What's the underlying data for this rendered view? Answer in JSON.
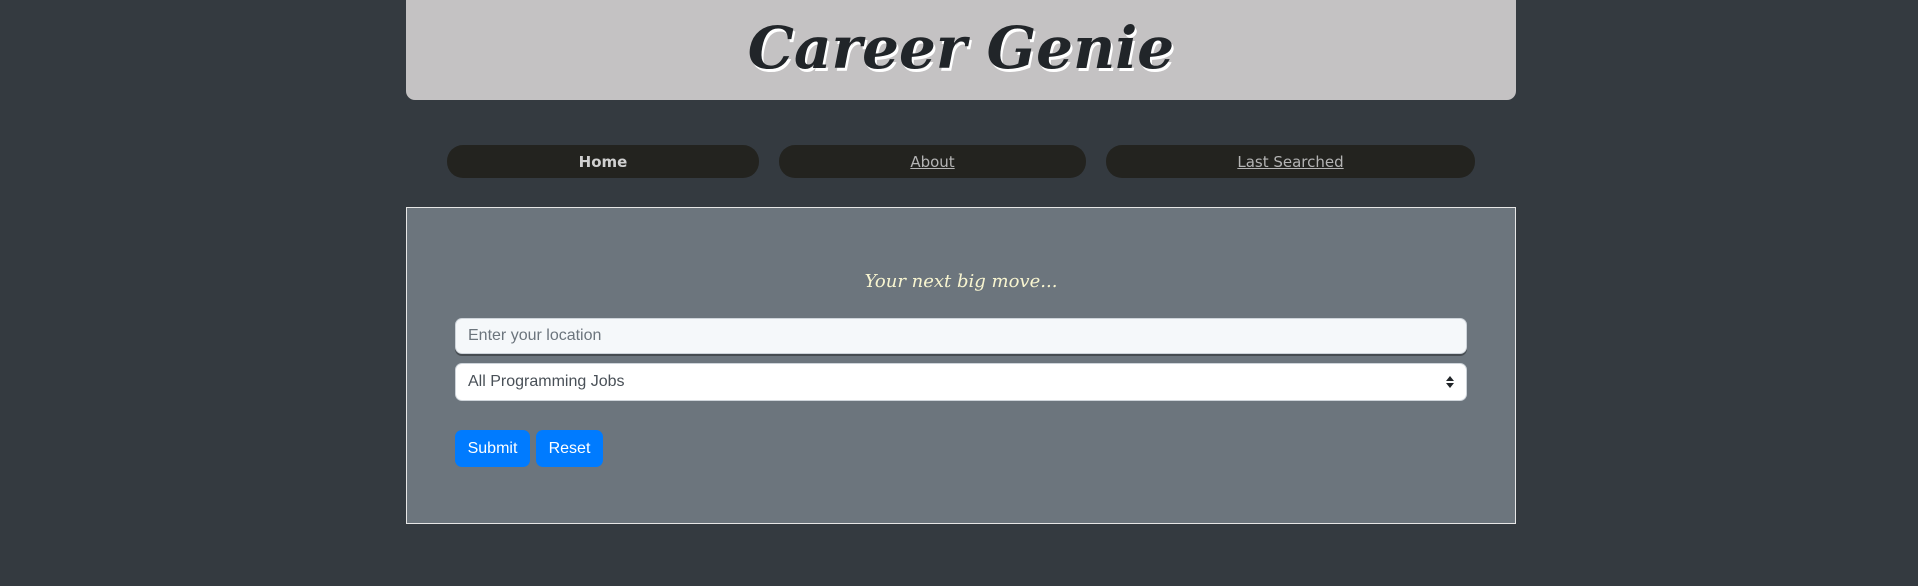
{
  "header": {
    "title": "Career Genie"
  },
  "nav": {
    "items": [
      {
        "label": "Home",
        "active": true
      },
      {
        "label": "About",
        "active": false
      },
      {
        "label": "Last Searched",
        "active": false
      }
    ]
  },
  "search": {
    "tagline": "Your next big move...",
    "location_placeholder": "Enter your location",
    "location_value": "",
    "job_type_selected": "All Programming Jobs",
    "submit_label": "Submit",
    "reset_label": "Reset"
  },
  "colors": {
    "page_background": "#343a40",
    "header_background": "#c4c2c3",
    "nav_pill": "#23231f",
    "panel_background": "#6c757d",
    "primary_button": "#007bff",
    "tagline": "#f8f5d0"
  }
}
